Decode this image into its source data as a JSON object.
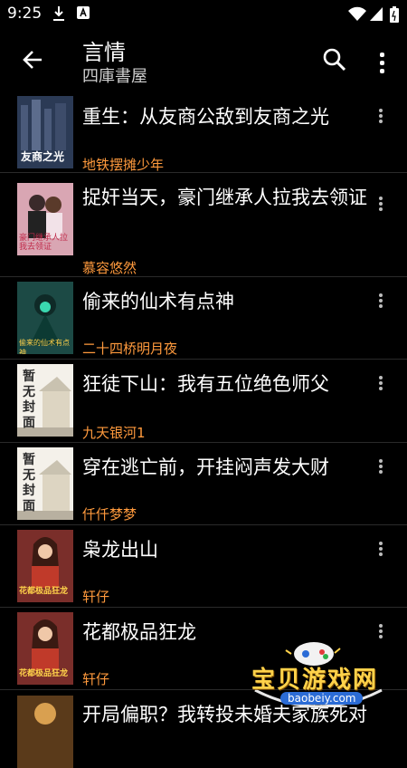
{
  "status": {
    "time": "9:25"
  },
  "appbar": {
    "title": "言情",
    "subtitle": "四庫書屋"
  },
  "books": [
    {
      "title": "重生：从友商公敌到友商之光",
      "author": "地铁摆摊少年",
      "cover_text": "友商之光",
      "cover_color": "#2b3a55"
    },
    {
      "title": "捉奸当天，豪门继承人拉我去领证",
      "author": "慕容悠然",
      "cover_text": "豪门继承人拉我去领证",
      "cover_color": "#d9a6b3"
    },
    {
      "title": "偷来的仙术有点神",
      "author": "二十四桥明月夜",
      "cover_text": "偷来的仙术有点神",
      "cover_color": "#1c4a45"
    },
    {
      "title": "狂徒下山：我有五位绝色师父",
      "author": "九天银河1",
      "cover_text": "暂无封面",
      "cover_color": "#f4f1ea"
    },
    {
      "title": "穿在逃亡前，开挂闷声发大财",
      "author": "仟仟梦梦",
      "cover_text": "暂无封面",
      "cover_color": "#f4f1ea"
    },
    {
      "title": "枭龙出山",
      "author": "轩仔",
      "cover_text": "花都极品狂龙",
      "cover_color": "#7a2e2a"
    },
    {
      "title": "花都极品狂龙",
      "author": "轩仔",
      "cover_text": "花都极品狂龙",
      "cover_color": "#7a2e2a"
    },
    {
      "title": "开局偏职？我转投未婚夫家族死对头怀抱",
      "author": "",
      "cover_text": "",
      "cover_color": "#5a3a1a"
    }
  ],
  "watermark": {
    "text": "宝贝游戏网",
    "url": "baobeiy.com"
  }
}
